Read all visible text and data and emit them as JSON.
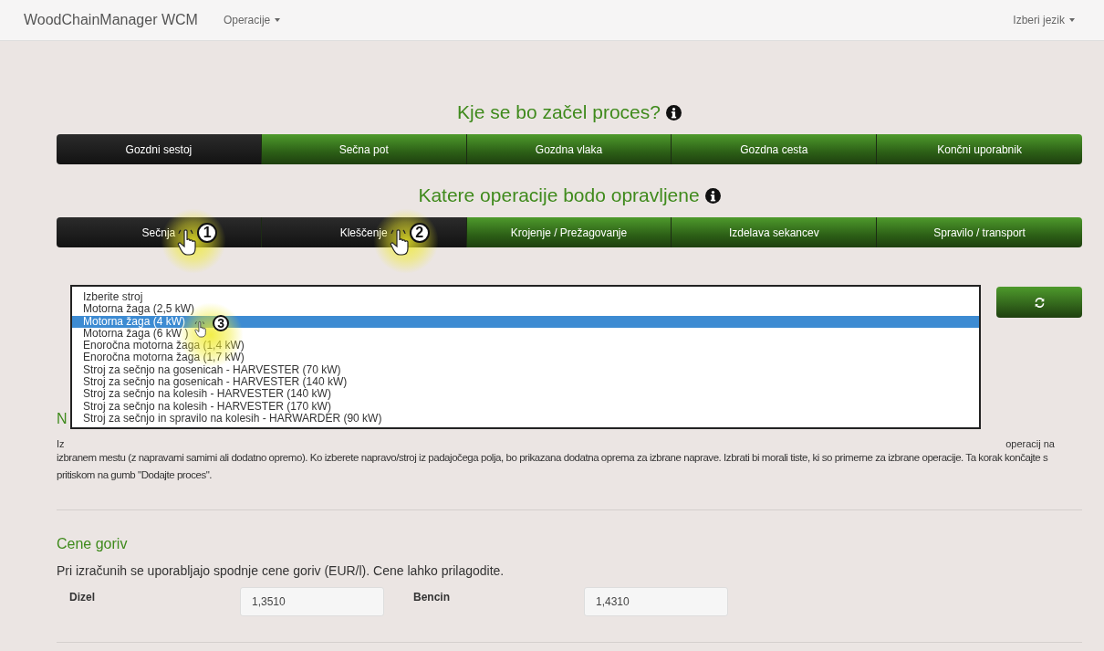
{
  "navbar": {
    "brand": "WoodChainManager WCM",
    "menu": "Operacije",
    "language": "Izberi jezik"
  },
  "start_section": {
    "title": "Kje se bo začel proces?",
    "tabs": [
      {
        "label": "Gozdni sestoj",
        "selected": true
      },
      {
        "label": "Sečna pot",
        "selected": false
      },
      {
        "label": "Gozdna vlaka",
        "selected": false
      },
      {
        "label": "Gozdna cesta",
        "selected": false
      },
      {
        "label": "Končni uporabnik",
        "selected": false
      }
    ]
  },
  "operations_section": {
    "title": "Katere operacije bodo opravljene",
    "tabs": [
      {
        "label": "Sečnja",
        "selected": true,
        "annotation": "1"
      },
      {
        "label": "Kleščenje",
        "selected": true,
        "annotation": "2"
      },
      {
        "label": "Krojenje / Prežagovanje",
        "selected": false
      },
      {
        "label": "Izdelava sekancev",
        "selected": false
      },
      {
        "label": "Spravilo / transport",
        "selected": false
      }
    ]
  },
  "machine_dropdown": {
    "options": [
      {
        "label": "Izberite stroj",
        "selected": false
      },
      {
        "label": "Motorna žaga (2,5 kW)",
        "selected": false
      },
      {
        "label": "Motorna žaga (4 kW)",
        "selected": true,
        "annotation": "3"
      },
      {
        "label": "Motorna žaga (6 kW )",
        "selected": false
      },
      {
        "label": "Enoročna motorna žaga (1,4 kW)",
        "selected": false
      },
      {
        "label": "Enoročna motorna žaga (1,7 kW)",
        "selected": false
      },
      {
        "label": "Stroj za sečnjo na gosenicah - HARVESTER (70 kW)",
        "selected": false
      },
      {
        "label": "Stroj za sečnjo na gosenicah - HARVESTER (140 kW)",
        "selected": false
      },
      {
        "label": "Stroj za sečnjo na kolesih - HARVESTER (140 kW)",
        "selected": false
      },
      {
        "label": "Stroj za sečnjo na kolesih - HARVESTER (170 kW)",
        "selected": false
      },
      {
        "label": "Stroj za sečnjo in spravilo na kolesih - HARWARDER (90 kW)",
        "selected": false
      }
    ]
  },
  "description": {
    "title_visible": "N",
    "line1_start": "Iz",
    "line1_end": "operacij na",
    "text": "izbranem mestu (z napravami samimi ali dodatno opremo). Ko izberete napravo/stroj iz padajočega polja, bo prikazana dodatna oprema za izbrane naprave. Izbrati bi morali tiste, ki so primerne za izbrane operacije. Ta korak končajte s pritiskom na gumb \"Dodajte proces\"."
  },
  "fuel_prices": {
    "title": "Cene goriv",
    "text": "Pri izračunih se uporabljajo spodnje cene goriv (EUR/l). Cene lahko prilagodite.",
    "fields": [
      {
        "label": "Dizel",
        "value": "1,3510"
      },
      {
        "label": "Bencin",
        "value": "1,4310"
      }
    ]
  }
}
